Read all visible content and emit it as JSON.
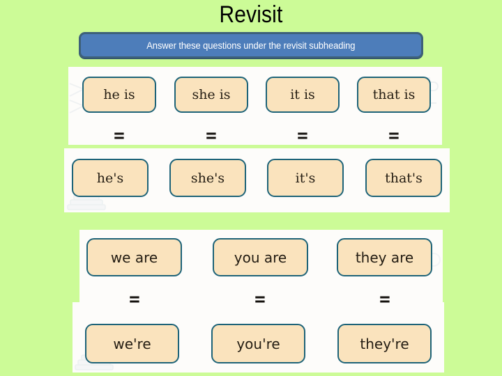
{
  "slide": {
    "title": "Revisit",
    "instruction": "Answer these questions under the revisit subheading",
    "background_color": "#ccfb97",
    "banner_color": "#4d7dba",
    "banner_border_color": "#3d6079",
    "box_fill_color": "#fae3bd",
    "box_border_color": "#1d6378",
    "equals_symbol": "="
  },
  "groups": [
    {
      "name": "is-contractions",
      "pairs": [
        {
          "full": "he is",
          "contraction": "he's"
        },
        {
          "full": "she is",
          "contraction": "she's"
        },
        {
          "full": "it is",
          "contraction": "it's"
        },
        {
          "full": "that is",
          "contraction": "that's"
        }
      ]
    },
    {
      "name": "are-contractions",
      "pairs": [
        {
          "full": "we are",
          "contraction": "we're"
        },
        {
          "full": "you are",
          "contraction": "you're"
        },
        {
          "full": "they are",
          "contraction": "they're"
        }
      ]
    }
  ]
}
